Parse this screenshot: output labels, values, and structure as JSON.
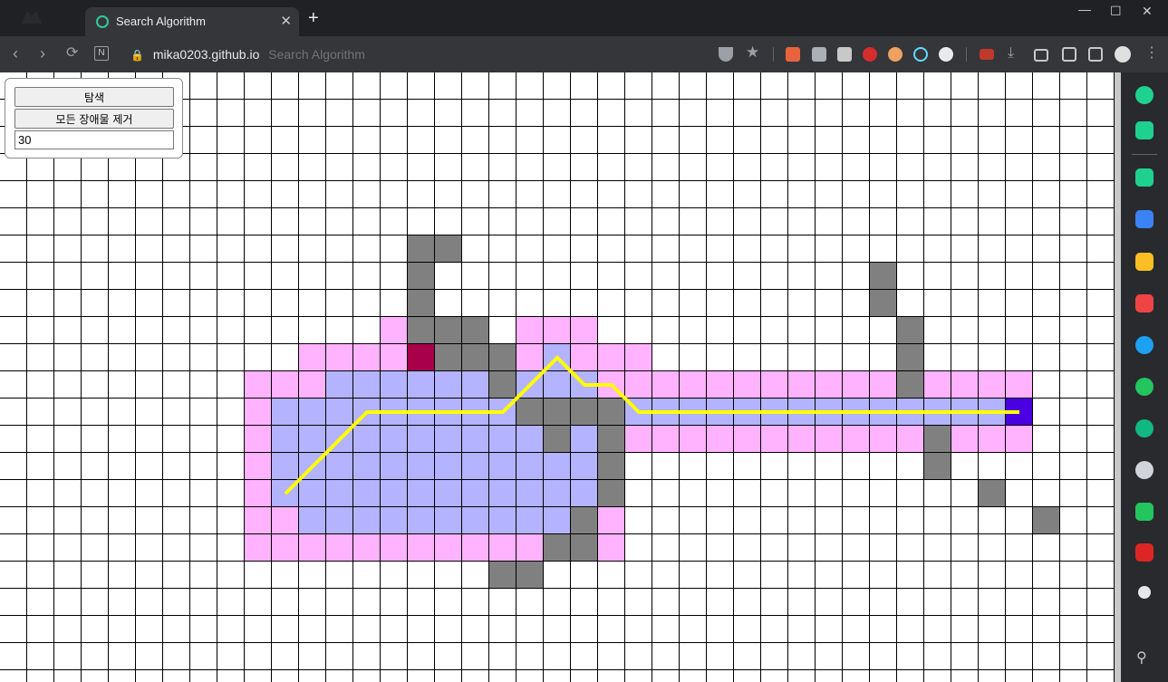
{
  "browser": {
    "tab_title": "Search Algorithm",
    "address_host": "mika0203.github.io",
    "address_title": "Search Algorithm"
  },
  "controls": {
    "search_label": "탐색",
    "clear_label": "모든 장애물 제거",
    "input_value": "30"
  },
  "colors": {
    "wall": "#808080",
    "open": "#ffb3ff",
    "closed": "#b3b3ff",
    "start": "#a8004a",
    "goal": "#4a00e0",
    "path": "#ffff00",
    "grid_line": "#000000"
  },
  "grid": {
    "rows": 23,
    "cols": 41,
    "start": [
      15,
      10
    ],
    "goal": [
      37,
      12
    ],
    "walls": [
      [
        15,
        6
      ],
      [
        16,
        6
      ],
      [
        32,
        7
      ],
      [
        15,
        7
      ],
      [
        32,
        8
      ],
      [
        15,
        8
      ],
      [
        15,
        9
      ],
      [
        16,
        9
      ],
      [
        17,
        9
      ],
      [
        33,
        9
      ],
      [
        16,
        10
      ],
      [
        17,
        10
      ],
      [
        18,
        10
      ],
      [
        33,
        10
      ],
      [
        18,
        11
      ],
      [
        33,
        11
      ],
      [
        19,
        12
      ],
      [
        20,
        12
      ],
      [
        21,
        12
      ],
      [
        22,
        12
      ],
      [
        20,
        13
      ],
      [
        34,
        13
      ],
      [
        34,
        14
      ],
      [
        22,
        13
      ],
      [
        22,
        14
      ],
      [
        22,
        15
      ],
      [
        36,
        15
      ],
      [
        21,
        16
      ],
      [
        38,
        16
      ],
      [
        20,
        17
      ],
      [
        21,
        17
      ],
      [
        18,
        18
      ],
      [
        19,
        18
      ]
    ],
    "closed_cells": [
      [
        15,
        10
      ],
      [
        20,
        10
      ],
      [
        12,
        11
      ],
      [
        13,
        11
      ],
      [
        14,
        11
      ],
      [
        15,
        11
      ],
      [
        16,
        11
      ],
      [
        17,
        11
      ],
      [
        19,
        11
      ],
      [
        20,
        11
      ],
      [
        21,
        11
      ],
      [
        10,
        12
      ],
      [
        11,
        12
      ],
      [
        12,
        12
      ],
      [
        13,
        12
      ],
      [
        14,
        12
      ],
      [
        15,
        12
      ],
      [
        16,
        12
      ],
      [
        17,
        12
      ],
      [
        18,
        12
      ],
      [
        23,
        12
      ],
      [
        24,
        12
      ],
      [
        25,
        12
      ],
      [
        26,
        12
      ],
      [
        27,
        12
      ],
      [
        28,
        12
      ],
      [
        29,
        12
      ],
      [
        30,
        12
      ],
      [
        31,
        12
      ],
      [
        32,
        12
      ],
      [
        33,
        12
      ],
      [
        34,
        12
      ],
      [
        35,
        12
      ],
      [
        36,
        12
      ],
      [
        10,
        13
      ],
      [
        11,
        13
      ],
      [
        12,
        13
      ],
      [
        13,
        13
      ],
      [
        14,
        13
      ],
      [
        15,
        13
      ],
      [
        16,
        13
      ],
      [
        17,
        13
      ],
      [
        18,
        13
      ],
      [
        19,
        13
      ],
      [
        21,
        13
      ],
      [
        10,
        14
      ],
      [
        11,
        14
      ],
      [
        12,
        14
      ],
      [
        13,
        14
      ],
      [
        14,
        14
      ],
      [
        15,
        14
      ],
      [
        16,
        14
      ],
      [
        17,
        14
      ],
      [
        18,
        14
      ],
      [
        19,
        14
      ],
      [
        20,
        14
      ],
      [
        21,
        14
      ],
      [
        10,
        15
      ],
      [
        11,
        15
      ],
      [
        12,
        15
      ],
      [
        13,
        15
      ],
      [
        14,
        15
      ],
      [
        15,
        15
      ],
      [
        16,
        15
      ],
      [
        17,
        15
      ],
      [
        18,
        15
      ],
      [
        19,
        15
      ],
      [
        20,
        15
      ],
      [
        21,
        15
      ],
      [
        11,
        16
      ],
      [
        12,
        16
      ],
      [
        13,
        16
      ],
      [
        14,
        16
      ],
      [
        15,
        16
      ],
      [
        16,
        16
      ],
      [
        17,
        16
      ],
      [
        18,
        16
      ],
      [
        19,
        16
      ],
      [
        20,
        16
      ]
    ],
    "open_cells": [
      [
        14,
        9
      ],
      [
        19,
        9
      ],
      [
        20,
        9
      ],
      [
        21,
        9
      ],
      [
        11,
        10
      ],
      [
        12,
        10
      ],
      [
        13,
        10
      ],
      [
        14,
        10
      ],
      [
        19,
        10
      ],
      [
        21,
        10
      ],
      [
        22,
        10
      ],
      [
        23,
        10
      ],
      [
        9,
        11
      ],
      [
        10,
        11
      ],
      [
        11,
        11
      ],
      [
        22,
        11
      ],
      [
        23,
        11
      ],
      [
        24,
        11
      ],
      [
        25,
        11
      ],
      [
        26,
        11
      ],
      [
        27,
        11
      ],
      [
        28,
        11
      ],
      [
        29,
        11
      ],
      [
        30,
        11
      ],
      [
        31,
        11
      ],
      [
        32,
        11
      ],
      [
        34,
        11
      ],
      [
        35,
        11
      ],
      [
        36,
        11
      ],
      [
        37,
        11
      ],
      [
        9,
        12
      ],
      [
        9,
        13
      ],
      [
        23,
        13
      ],
      [
        24,
        13
      ],
      [
        25,
        13
      ],
      [
        26,
        13
      ],
      [
        27,
        13
      ],
      [
        28,
        13
      ],
      [
        29,
        13
      ],
      [
        30,
        13
      ],
      [
        31,
        13
      ],
      [
        32,
        13
      ],
      [
        33,
        13
      ],
      [
        35,
        13
      ],
      [
        36,
        13
      ],
      [
        37,
        13
      ],
      [
        9,
        14
      ],
      [
        9,
        15
      ],
      [
        9,
        16
      ],
      [
        10,
        16
      ],
      [
        22,
        16
      ],
      [
        9,
        17
      ],
      [
        10,
        17
      ],
      [
        11,
        17
      ],
      [
        12,
        17
      ],
      [
        13,
        17
      ],
      [
        14,
        17
      ],
      [
        15,
        17
      ],
      [
        16,
        17
      ],
      [
        17,
        17
      ],
      [
        18,
        17
      ],
      [
        19,
        17
      ],
      [
        22,
        17
      ]
    ],
    "path_cells": [
      [
        10.5,
        15.5
      ],
      [
        13.5,
        12.5
      ],
      [
        18.5,
        12.5
      ],
      [
        20.5,
        10.5
      ],
      [
        21.5,
        11.5
      ],
      [
        22.5,
        11.5
      ],
      [
        23.5,
        12.5
      ],
      [
        37.5,
        12.5
      ]
    ]
  }
}
